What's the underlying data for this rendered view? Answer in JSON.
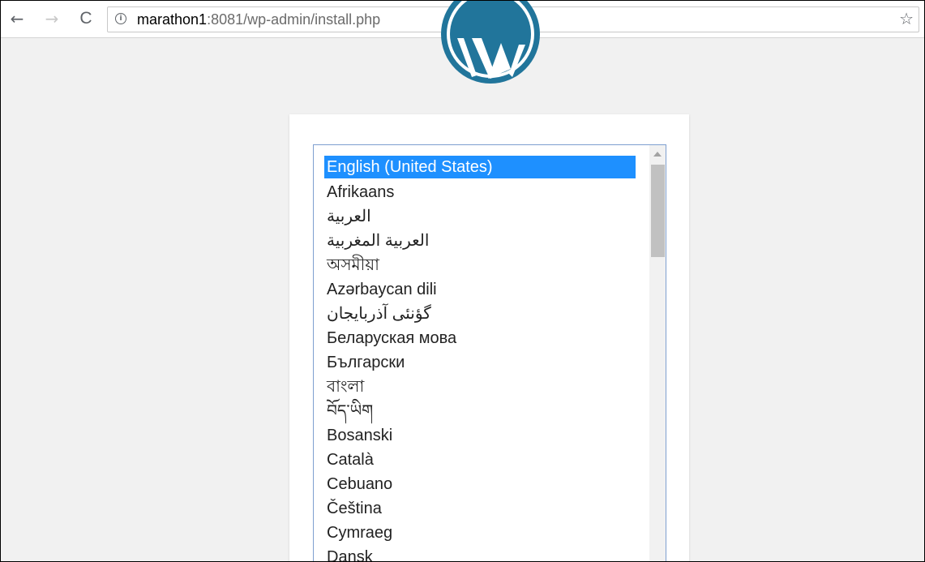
{
  "browser": {
    "back_glyph": "←",
    "forward_glyph": "→",
    "reload_glyph": "C",
    "info_glyph": "i",
    "url_host": "marathon1",
    "url_rest": ":8081/wp-admin/install.php",
    "star_glyph": "☆"
  },
  "language_select": {
    "selected": "English (United States)",
    "options": [
      "English (United States)",
      "Afrikaans",
      "العربية",
      "العربية المغربية",
      "অসমীয়া",
      "Azərbaycan dili",
      "گؤنئی آذربایجان",
      "Беларуская мова",
      "Български",
      "বাংলা",
      "བོད་ཡིག",
      "Bosanski",
      "Català",
      "Cebuano",
      "Čeština",
      "Cymraeg",
      "Dansk"
    ]
  },
  "colors": {
    "wp_blue": "#21759b",
    "selection": "#1e90ff",
    "page_bg": "#f1f1f1"
  }
}
